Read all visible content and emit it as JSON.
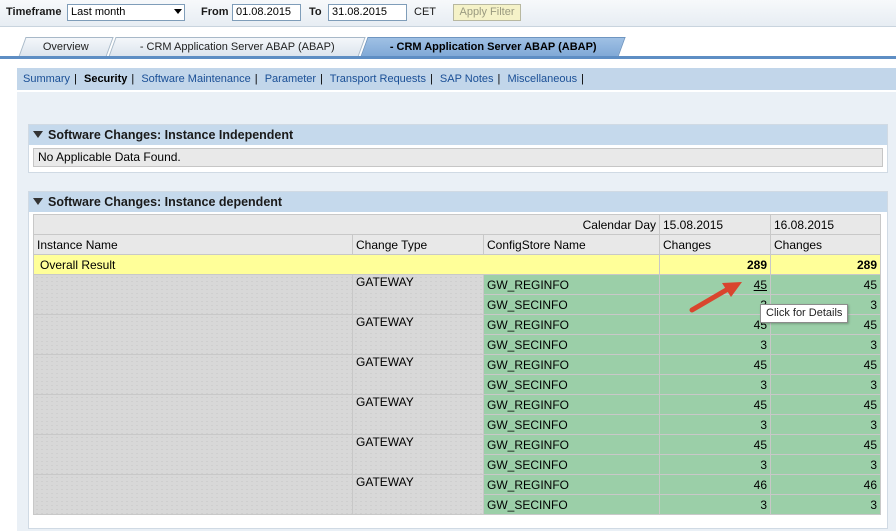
{
  "filter": {
    "timeframe_label": "Timeframe",
    "timeframe_value": "Last month",
    "from_label": "From",
    "from_value": "01.08.2015",
    "to_label": "To",
    "to_value": "31.08.2015",
    "tz": "CET",
    "apply_label": "Apply Filter"
  },
  "tabs": [
    {
      "label": "Overview"
    },
    {
      "label": "- CRM Application Server ABAP (ABAP)"
    },
    {
      "label": "- CRM Application Server ABAP (ABAP)"
    }
  ],
  "subnav": [
    {
      "label": "Summary"
    },
    {
      "label": "Security"
    },
    {
      "label": "Software Maintenance"
    },
    {
      "label": "Parameter"
    },
    {
      "label": "Transport Requests"
    },
    {
      "label": "SAP Notes"
    },
    {
      "label": "Miscellaneous"
    }
  ],
  "panel1": {
    "title": "Software Changes: Instance Independent",
    "message": "No Applicable Data Found."
  },
  "panel2": {
    "title": "Software Changes: Instance dependent",
    "calendar_day_label": "Calendar Day",
    "date1": "15.08.2015",
    "date2": "16.08.2015",
    "col_instance": "Instance Name",
    "col_change_type": "Change Type",
    "col_configstore": "ConfigStore Name",
    "col_changes1": "Changes",
    "col_changes2": "Changes",
    "overall_label": "Overall Result",
    "overall1": "289",
    "overall2": "289",
    "groups": [
      {
        "type": "GATEWAY",
        "rows": [
          {
            "name": "GW_REGINFO",
            "v1": "45",
            "v2": "45"
          },
          {
            "name": "GW_SECINFO",
            "v1": "3",
            "v2": "3"
          }
        ]
      },
      {
        "type": "GATEWAY",
        "rows": [
          {
            "name": "GW_REGINFO",
            "v1": "45",
            "v2": "45"
          },
          {
            "name": "GW_SECINFO",
            "v1": "3",
            "v2": "3"
          }
        ]
      },
      {
        "type": "GATEWAY",
        "rows": [
          {
            "name": "GW_REGINFO",
            "v1": "45",
            "v2": "45"
          },
          {
            "name": "GW_SECINFO",
            "v1": "3",
            "v2": "3"
          }
        ]
      },
      {
        "type": "GATEWAY",
        "rows": [
          {
            "name": "GW_REGINFO",
            "v1": "45",
            "v2": "45"
          },
          {
            "name": "GW_SECINFO",
            "v1": "3",
            "v2": "3"
          }
        ]
      },
      {
        "type": "GATEWAY",
        "rows": [
          {
            "name": "GW_REGINFO",
            "v1": "45",
            "v2": "45"
          },
          {
            "name": "GW_SECINFO",
            "v1": "3",
            "v2": "3"
          }
        ]
      },
      {
        "type": "GATEWAY",
        "rows": [
          {
            "name": "GW_REGINFO",
            "v1": "46",
            "v2": "46"
          },
          {
            "name": "GW_SECINFO",
            "v1": "3",
            "v2": "3"
          }
        ]
      }
    ]
  },
  "tooltip": "Click for Details",
  "colors": {
    "overall_row": "#ffff99",
    "config_cells": "#9bcfa8",
    "annotation_arrow": "#d9452e"
  }
}
